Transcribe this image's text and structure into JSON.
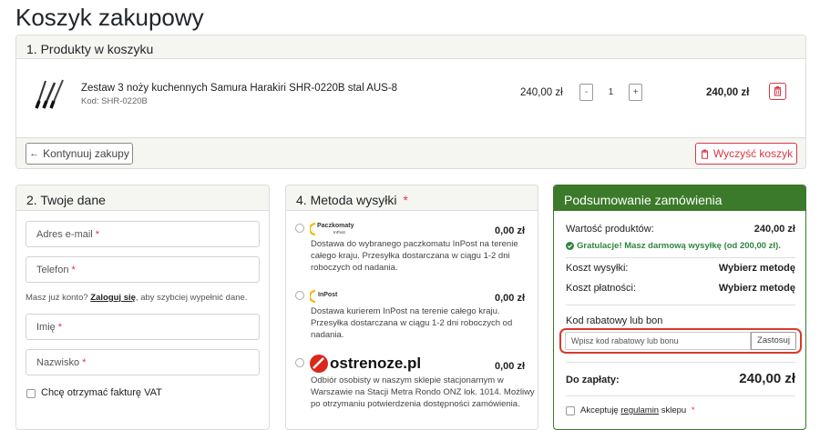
{
  "page": {
    "title": "Koszyk zakupowy"
  },
  "cart": {
    "header": "1. Produkty w koszyku",
    "item": {
      "name": "Zestaw 3 noży kuchennych Samura Harakiri SHR-0220B stal AUS-8",
      "code": "Kod: SHR-0220B",
      "unit_price": "240,00 zł",
      "quantity": "1",
      "minus": "-",
      "plus": "+",
      "total": "240,00 zł"
    },
    "continue_label": "Kontynuuj zakupy",
    "clear_label": "Wyczyść koszyk"
  },
  "customer": {
    "header": "2. Twoje dane",
    "email_placeholder": "Adres e-mail",
    "phone_placeholder": "Telefon",
    "account_text": "Masz już konto?",
    "login_link": "Zaloguj się",
    "account_suffix": ", aby szybciej wypełnić dane.",
    "first_name_placeholder": "Imię",
    "last_name_placeholder": "Nazwisko",
    "vat_label": "Chcę otrzymać fakturę VAT",
    "required_mark": "*"
  },
  "shipping": {
    "header": "4. Metoda wysyłki",
    "required_mark": "*",
    "options": [
      {
        "logo": "Paczkomaty",
        "logo_sub": "InPost",
        "price": "0,00 zł",
        "description": "Dostawa do wybranego paczkomatu InPost na terenie całego kraju. Przesyłka dostarczana w ciągu 1-2 dni roboczych od nadania."
      },
      {
        "logo": "InPost",
        "price": "0,00 zł",
        "description": "Dostawa kurierem InPost na terenie całego kraju. Przesyłka dostarczana w ciągu 1-2 dni roboczych od nadania."
      },
      {
        "logo": "ostrenoze.pl",
        "price": "0,00 zł",
        "description": "Odbiór osobisty w naszym sklepie stacjonarnym w Warszawie na Stacji Metra Rondo ONZ lok. 1014. Możliwy po otrzymaniu potwierdzenia dostępności zamówienia."
      }
    ]
  },
  "summary": {
    "header": "Podsumowanie zamówienia",
    "products_label": "Wartość produktów:",
    "products_value": "240,00 zł",
    "free_shipping_note": "Gratulacje! Masz darmową wysyłkę (od 200,00 zł).",
    "shipping_label": "Koszt wysyłki:",
    "shipping_value": "Wybierz metodę",
    "payment_label": "Koszt płatności:",
    "payment_value": "Wybierz metodę",
    "coupon_label": "Kod rabatowy lub bon",
    "coupon_placeholder": "Wpisz kod rabatowy lub bonu",
    "coupon_apply": "Zastosuj",
    "total_label": "Do zapłaty:",
    "total_value": "240,00 zł",
    "terms_prefix": "Akceptuję",
    "terms_link": "regulamin",
    "terms_suffix": "sklepu",
    "required_mark": "*"
  },
  "colors": {
    "brand_green": "#3b7a2a",
    "danger_red": "#dc3545",
    "success_green": "#2e8540"
  }
}
